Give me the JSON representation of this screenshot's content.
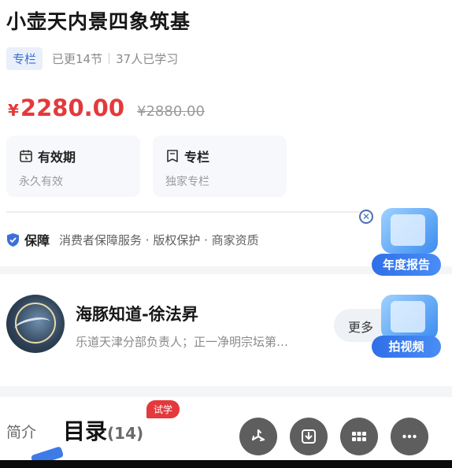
{
  "course": {
    "title": "小壶天内景四象筑基",
    "tag": "专栏",
    "updated": "已更14节",
    "learners": "37人已学习"
  },
  "price": {
    "symbol": "¥",
    "current": "2280.00",
    "original": "¥2880.00",
    "accent_color": "#e4393c"
  },
  "cards": [
    {
      "icon": "calendar-icon",
      "title": "有效期",
      "sub": "永久有效"
    },
    {
      "icon": "bookmark-icon",
      "title": "专栏",
      "sub": "独家专栏"
    }
  ],
  "guarantee": {
    "icon": "shield-check-icon",
    "title": "保障",
    "text": "消费者保障服务 · 版权保护 · 商家资质"
  },
  "author": {
    "name": "海豚知道-徐法昇",
    "desc": "乐道天津分部负责人；正一净明宗坛第…",
    "more": "更多"
  },
  "tabs": {
    "intro": "简介",
    "catalog": "目录",
    "catalog_count": "(14)",
    "trial_badge": "试学"
  },
  "floating": {
    "report_label": "年度报告",
    "video_label": "拍视频",
    "close": "✕"
  },
  "actions": [
    {
      "icon": "pinwheel-icon"
    },
    {
      "icon": "download-icon"
    },
    {
      "icon": "grid-icon"
    },
    {
      "icon": "more-dots-icon"
    }
  ]
}
